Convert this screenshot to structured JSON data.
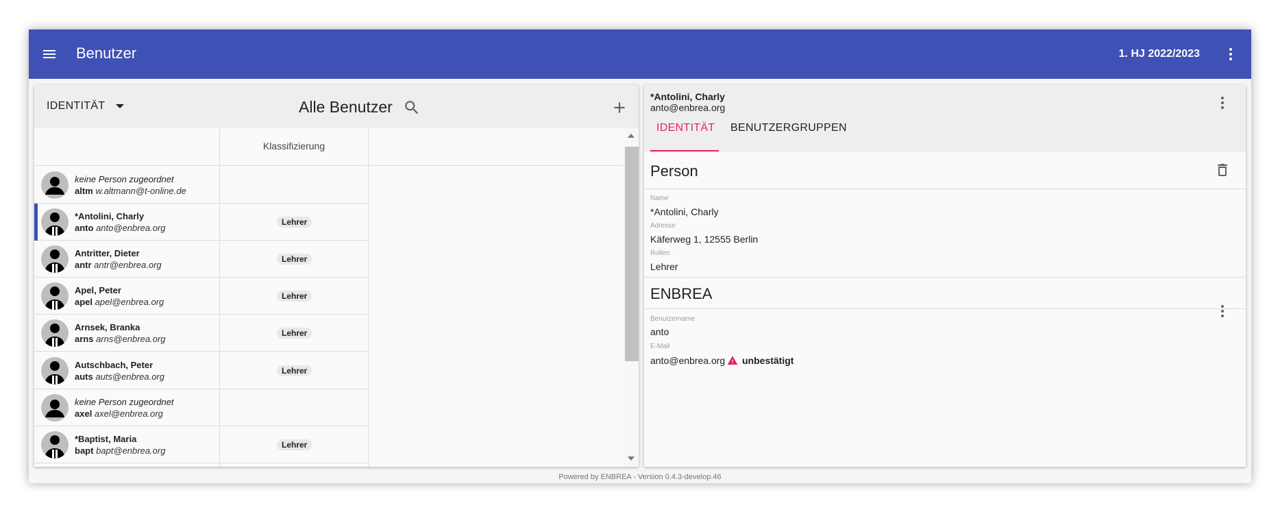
{
  "appbar": {
    "title": "Benutzer",
    "term": "1. HJ 2022/2023",
    "bg_color": "#3f51b5"
  },
  "left": {
    "identity_select": "IDENTITÄT",
    "list_title": "Alle Benutzer",
    "column_klassifizierung": "Klassifizierung",
    "rows": [
      {
        "name": "keine Person zugeordnet",
        "no_person": true,
        "login": "altm",
        "email": "w.altmann@t-online.de",
        "chip": ""
      },
      {
        "name": "*Antolini, Charly",
        "no_person": false,
        "login": "anto",
        "email": "anto@enbrea.org",
        "chip": "Lehrer",
        "selected": true
      },
      {
        "name": "Antritter, Dieter",
        "no_person": false,
        "login": "antr",
        "email": "antr@enbrea.org",
        "chip": "Lehrer"
      },
      {
        "name": "Apel, Peter",
        "no_person": false,
        "login": "apel",
        "email": "apel@enbrea.org",
        "chip": "Lehrer"
      },
      {
        "name": "Arnsek, Branka",
        "no_person": false,
        "login": "arns",
        "email": "arns@enbrea.org",
        "chip": "Lehrer"
      },
      {
        "name": "Autschbach, Peter",
        "no_person": false,
        "login": "auts",
        "email": "auts@enbrea.org",
        "chip": "Lehrer"
      },
      {
        "name": "keine Person zugeordnet",
        "no_person": true,
        "login": "axel",
        "email": "axel@enbrea.org",
        "chip": ""
      },
      {
        "name": "*Baptist, Maria",
        "no_person": false,
        "login": "bapt",
        "email": "bapt@enbrea.org",
        "chip": "Lehrer"
      }
    ]
  },
  "right": {
    "header_name": "*Antolini, Charly",
    "header_email": "anto@enbrea.org",
    "tabs": [
      "IDENTITÄT",
      "BENUTZERGRUPPEN"
    ],
    "active_tab_color": "#e91e63",
    "person": {
      "title": "Person",
      "name_label": "Name",
      "name_value": "*Antolini, Charly",
      "address_label": "Adresse",
      "address_value": "Käferweg 1, 12555 Berlin",
      "roles_label": "Rollen",
      "roles_value": "Lehrer"
    },
    "enbrea": {
      "title": "ENBREA",
      "username_label": "Benutzername",
      "username_value": "anto",
      "email_label": "E-Mail",
      "email_value": "anto@enbrea.org",
      "status": "unbestätigt"
    }
  },
  "footer": "Powered by ENBREA - Version 0.4.3-develop.46"
}
